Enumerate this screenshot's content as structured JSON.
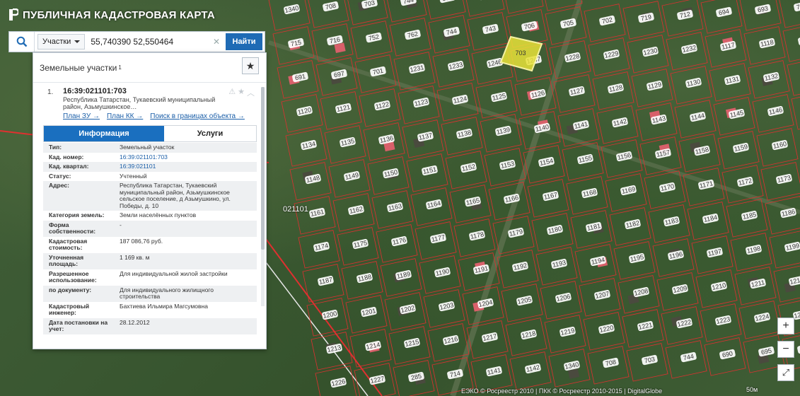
{
  "app": {
    "title": "ПУБЛИЧНАЯ КАДАСТРОВАЯ КАРТА"
  },
  "search": {
    "type_label": "Участки",
    "value": "55,740390 52,550464",
    "find_label": "Найти"
  },
  "panel": {
    "title": "Земельные участки",
    "count": "1"
  },
  "result": {
    "index": "1.",
    "cad_number": "16:39:021101:703",
    "address_short": "Республика Татарстан, Тукаевский муниципальный район, Азьмушкинское…",
    "links": [
      "План ЗУ →",
      "План КК →",
      "Поиск в границах объекта →"
    ],
    "tabs": [
      "Информация",
      "Услуги"
    ],
    "rows": [
      {
        "k": "Тип:",
        "v": "Земельный участок"
      },
      {
        "k": "Кад. номер:",
        "v": "16:39:021101:703"
      },
      {
        "k": "Кад. квартал:",
        "v": "16:39:021101"
      },
      {
        "k": "Статус:",
        "v": "Учтенный"
      },
      {
        "k": "Адрес:",
        "v": "Республика Татарстан, Тукаевский муниципальный район, Азьмушкинское сельское поселение, д Азьмушкино, ул. Победы, д. 10"
      },
      {
        "k": "Категория земель:",
        "v": "Земли населённых пунктов"
      },
      {
        "k": "Форма собственности:",
        "v": "-"
      },
      {
        "k": "Кадастровая стоимость:",
        "v": "187 086,76 руб."
      },
      {
        "k": "Уточненная площадь:",
        "v": "1 169 кв. м"
      },
      {
        "k": "Разрешенное использование:",
        "v": "Для индивидуальной жилой застройки"
      },
      {
        "k": "по документу:",
        "v": "Для индивидуального жилищного строительства"
      },
      {
        "k": "Кадастровый инженер:",
        "v": "Бахтиева Ильмира Магсумовна"
      },
      {
        "k": "Дата постановки на учет:",
        "v": "28.12.2012"
      }
    ]
  },
  "map": {
    "quarter_label": "021101",
    "copyright": "ЕЭКО © Росреестр 2010 | ПКК © Росреестр 2010-2015 | DigitalGlobe",
    "scale": "50м",
    "colors": {
      "boundary": "#e03030",
      "selected": "#e8e23a",
      "panel_accent": "#1a6fbf"
    },
    "plot_labels": [
      "1340",
      "708",
      "703",
      "744",
      "690",
      "695",
      "694",
      "711",
      "715",
      "716",
      "752",
      "762",
      "744",
      "743",
      "706",
      "705",
      "702",
      "719",
      "712",
      "694",
      "693",
      "707",
      "691",
      "697",
      "701",
      "1231",
      "1233",
      "1246",
      "1247",
      "1228",
      "1229",
      "1230",
      "1232",
      "1117",
      "1118",
      "1119",
      "1120",
      "1121",
      "1122",
      "1123",
      "1124",
      "1125",
      "1126",
      "1127",
      "1128",
      "1129",
      "1130",
      "1131",
      "1132",
      "1133",
      "1134",
      "1135",
      "1136",
      "1137",
      "1138",
      "1139",
      "1140",
      "1141",
      "1142",
      "1143",
      "1144",
      "1145",
      "1146",
      "1147",
      "1148",
      "1149",
      "1150",
      "1151",
      "1152",
      "1153",
      "1154",
      "1155",
      "1156",
      "1157",
      "1158",
      "1159",
      "1160",
      "1161",
      "1162",
      "1163",
      "1164",
      "1165",
      "1166",
      "1167",
      "1168",
      "1169",
      "1170",
      "1171",
      "1172",
      "1173",
      "1174",
      "1175",
      "1176",
      "1177",
      "1178",
      "1179",
      "1180",
      "1181",
      "1182",
      "1183",
      "1184",
      "1185",
      "1186",
      "1187",
      "1188",
      "1189",
      "1190",
      "1191",
      "1192",
      "1193",
      "1194",
      "1195",
      "1196",
      "1197",
      "1198",
      "1199",
      "1200",
      "1201",
      "1202",
      "1203",
      "1204",
      "1205",
      "1206",
      "1207",
      "1208",
      "1209",
      "1210",
      "1211",
      "1212",
      "1213",
      "1214",
      "1215",
      "1216",
      "1217",
      "1218",
      "1219",
      "1220",
      "1221",
      "1222",
      "1223",
      "1224",
      "1225",
      "1226",
      "1227",
      "285",
      "714",
      "1141",
      "1142"
    ],
    "zoom_in": "+",
    "zoom_out": "−",
    "fullscreen": "⤢"
  }
}
